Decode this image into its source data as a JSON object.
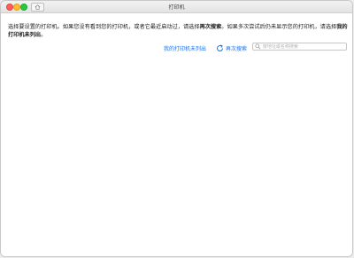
{
  "window": {
    "title": "打印机"
  },
  "instructions": {
    "p1": "选择要设置的打印机。如果您没有看到您的打印机，或者它最近启动过，请选择",
    "p1_bold": "再次搜索",
    "p2": "。如果多次尝试后仍未显示您的打印机，请选择",
    "p2_bold": "我的打印机未列出",
    "p3": "。"
  },
  "actions": {
    "not_listed_label": "我的打印机未列出",
    "search_again_label": "再次搜索",
    "search_placeholder": "按地址或名称搜索"
  },
  "colors": {
    "accent": "#1a73e8"
  },
  "icons": [
    "home-icon",
    "refresh-icon",
    "search-icon"
  ]
}
